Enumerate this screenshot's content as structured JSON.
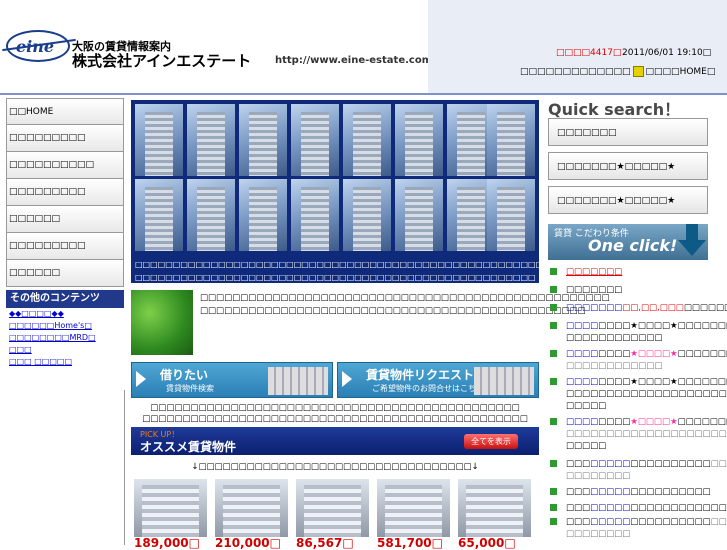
{
  "header": {
    "top_line": "",
    "logo_text": "eine",
    "subtitle": "大阪の賃貸情報案内",
    "company": "株式会社アインエステート",
    "url": "http://www.eine-estate.com",
    "counter": "4417",
    "datetime": "2011/06/01 19:10",
    "toplinks_a": "",
    "toplinks_b": "HOME"
  },
  "sidebar": {
    "items": [
      "HOME",
      "",
      "",
      "",
      "",
      "",
      ""
    ],
    "other_title": "その他のコンテンツ",
    "links": [
      "◆◆◆◆",
      "Home's",
      "MRD",
      "",
      ""
    ]
  },
  "main": {
    "gallery_caption": "",
    "intro": "",
    "button_rent_title": "借りたい",
    "button_rent_sub": "賃貸物件検索",
    "button_request_title": "賃貸物件リクエスト",
    "button_request_sub": "ご希望物件のお問合せはこちらから",
    "note": "",
    "pickup_small": "PICK UP！",
    "pickup_title": "オススメ賃貸物件",
    "show_all": "全てを表示",
    "arrow_text": "↓↓",
    "prices": [
      "189,000",
      "210,000",
      "86,567",
      "581,700",
      "65,000"
    ]
  },
  "right": {
    "quick_search": "Quick search！",
    "btn1": "",
    "btn2": "★★",
    "btn3": "★★",
    "oneclick_small": "賃貸 こだわり条件",
    "oneclick_big": "One click!",
    "list": [
      {
        "t": ""
      },
      {
        "t": ""
      },
      {
        "t": ",,"
      },
      {
        "t": "★★"
      },
      {
        "t": "★"
      },
      {
        "t": "★★"
      },
      {
        "t": "★★"
      },
      {
        "t": ""
      },
      {
        "t": ""
      },
      {
        "t": ""
      },
      {
        "t": ""
      }
    ]
  },
  "colors": {
    "navy": "#0f2a7a",
    "accent_red": "#e00000",
    "link_blue": "#0000cc",
    "header_bg": "#e9eef6"
  }
}
